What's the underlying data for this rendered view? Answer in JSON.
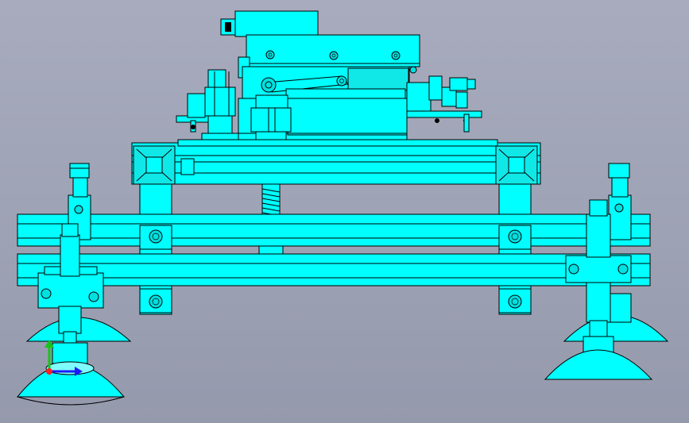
{
  "viewport": {
    "background": "#9ea3b5",
    "model_color": "#00ffff",
    "edge_color": "#000000"
  },
  "triad": {
    "axes": [
      {
        "name": "x",
        "color": "#1a1aff"
      },
      {
        "name": "y",
        "color": "#19c219"
      },
      {
        "name": "z",
        "color": "#ff2020"
      }
    ]
  }
}
